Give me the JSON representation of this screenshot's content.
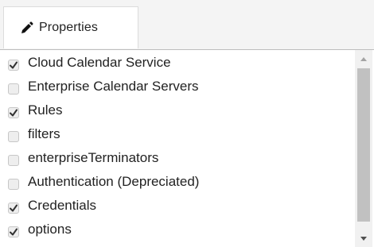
{
  "tab": {
    "label": "Properties",
    "icon": "pencil-icon"
  },
  "items": [
    {
      "label": "Cloud Calendar Service",
      "checked": true
    },
    {
      "label": "Enterprise Calendar Servers",
      "checked": false
    },
    {
      "label": "Rules",
      "checked": true
    },
    {
      "label": "filters",
      "checked": false
    },
    {
      "label": "enterpriseTerminators",
      "checked": false
    },
    {
      "label": "Authentication (Depreciated)",
      "checked": false
    },
    {
      "label": "Credentials",
      "checked": true
    },
    {
      "label": "options",
      "checked": true
    }
  ],
  "colors": {
    "checkbox_bg": "#eeeeee",
    "checkmark": "#333333",
    "scroll_thumb": "#c1c1c1",
    "scroll_track": "#f1f1f1"
  }
}
